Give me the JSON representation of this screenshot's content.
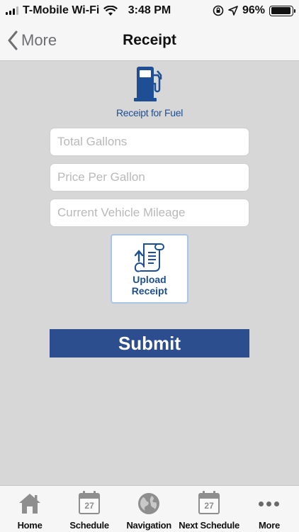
{
  "status_bar": {
    "carrier": "T-Mobile Wi-Fi",
    "time": "3:48 PM",
    "battery": "96%",
    "battery_level": 0.96
  },
  "nav": {
    "back_label": "More",
    "title": "Receipt"
  },
  "fuel": {
    "icon": "fuel-pump-icon",
    "caption": "Receipt for Fuel"
  },
  "form": {
    "total_gallons": {
      "value": "",
      "placeholder": "Total Gallons"
    },
    "price_per_gallon": {
      "value": "",
      "placeholder": "Price Per Gallon"
    },
    "vehicle_mileage": {
      "value": "",
      "placeholder": "Current Vehicle Mileage"
    },
    "upload": {
      "label_line1": "Upload",
      "label_line2": "Receipt",
      "icon": "receipt-upload-icon"
    },
    "submit_label": "Submit"
  },
  "tabs": [
    {
      "label": "Home",
      "icon": "home-icon"
    },
    {
      "label": "Schedule",
      "icon": "calendar-icon",
      "day": "27"
    },
    {
      "label": "Navigation",
      "icon": "globe-icon"
    },
    {
      "label": "Next Schedule",
      "icon": "calendar-icon",
      "day": "27"
    },
    {
      "label": "More",
      "icon": "more-dots-icon"
    }
  ],
  "colors": {
    "brand_blue": "#1e4f94",
    "submit_bg": "#2c4e8e",
    "background": "#d7d7d7"
  }
}
